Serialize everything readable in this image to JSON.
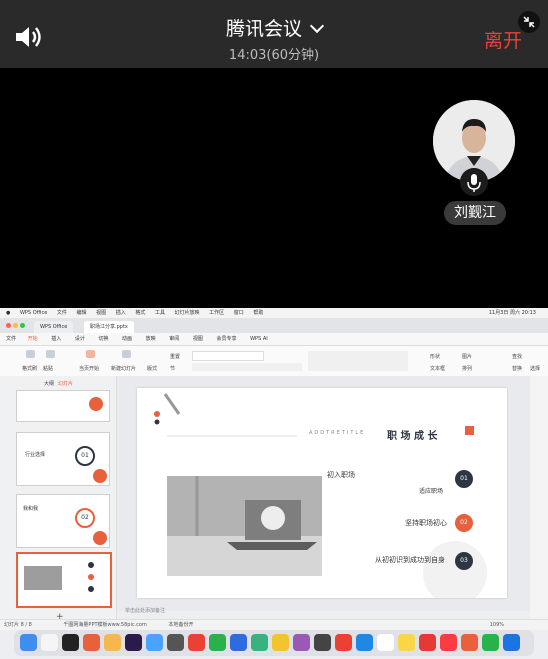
{
  "meeting": {
    "title": "腾讯会议",
    "time": "14:03(60分钟)",
    "leave_label": "离开"
  },
  "participant": {
    "name": "刘觐江"
  },
  "icons": {
    "speaker": "speaker-icon",
    "chevron": "chevron-down-icon",
    "shrink": "shrink-icon",
    "mic": "microphone-icon"
  },
  "colors": {
    "leave": "#e8433a",
    "accent_orange": "#e8603c",
    "dark_navy": "#2f3542"
  },
  "shared_screen": {
    "os_menu": [
      "WPS Office",
      "文件",
      "编辑",
      "视图",
      "插入",
      "格式",
      "工具",
      "幻灯片放映",
      "工作区",
      "窗口",
      "帮助"
    ],
    "os_clock": "11月3日 周六 20:13",
    "tabs": [
      "WPS Office",
      "职场江分享.pptx"
    ],
    "menu_items": [
      "文件",
      "开始",
      "插入",
      "设计",
      "切换",
      "动画",
      "放映",
      "审阅",
      "视图",
      "会员专享",
      "WPS AI"
    ],
    "ribbon_labels": [
      "格式刷",
      "粘贴",
      "当页开始",
      "新建幻灯片",
      "版式",
      "节",
      "重置",
      "形状",
      "图片",
      "文本框",
      "排列",
      "查找",
      "替换",
      "选择"
    ],
    "panel_tabs": [
      "大纲",
      "幻灯片"
    ],
    "thumb_texts": [
      "行业选择",
      "01",
      "我和我",
      "02"
    ],
    "slide": {
      "subtitle": "ADDTRETITLE",
      "title": "职 场 成 长",
      "items": [
        {
          "text": "初入职场",
          "num": "01"
        },
        {
          "text": "适应职场",
          "num": ""
        },
        {
          "text": "坚持职场初心",
          "num": "02"
        },
        {
          "text": "从初初识到成功到自身",
          "num": "03"
        }
      ]
    },
    "notes_placeholder": "单击此处添加备注",
    "status_left": "幻灯片 8 / 8",
    "status_center": "千图网海量PPT模板www.58pic.com",
    "status_right": "本地备份开",
    "zoom": "109%"
  }
}
